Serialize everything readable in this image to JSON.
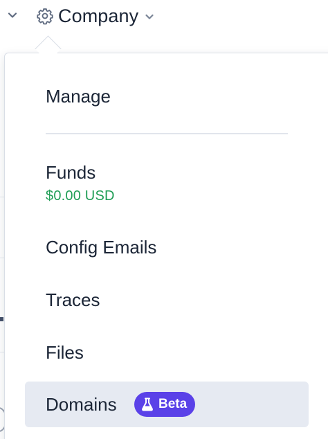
{
  "header": {
    "company_label": "Company",
    "icons": {
      "left": "chevron-down-icon",
      "gear": "gear-icon",
      "dropdown": "chevron-down-icon"
    }
  },
  "dropdown": {
    "items": {
      "manage": "Manage",
      "funds": "Funds",
      "funds_amount": "$0.00 USD",
      "config_emails": "Config Emails",
      "traces": "Traces",
      "files": "Files",
      "domains": "Domains"
    },
    "badge": {
      "label": "Beta",
      "icon": "flask-icon"
    }
  },
  "colors": {
    "text": "#1b2536",
    "funds_amount": "#1f9d55",
    "badge": "#5a41e8",
    "highlight_row": "#e6eaf2",
    "divider": "#e1e5ec"
  }
}
